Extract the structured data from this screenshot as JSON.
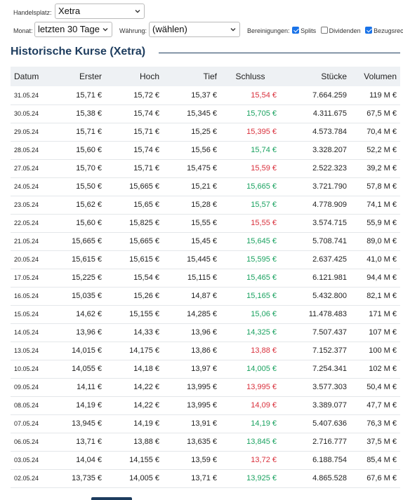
{
  "filters": {
    "exchange_label": "Handelsplatz:",
    "exchange_value": "Xetra",
    "month_label": "Monat:",
    "month_value": "letzten 30 Tage",
    "currency_label": "Währung:",
    "currency_value": "(wählen)",
    "adjust_label": "Bereinigungen:",
    "adjust_options": [
      {
        "label": "Splits",
        "checked": true
      },
      {
        "label": "Dividenden",
        "checked": false
      },
      {
        "label": "Bezugsrec",
        "checked": true
      }
    ]
  },
  "section_title": "Historische Kurse (Xetra)",
  "table": {
    "headers": [
      "Datum",
      "Erster",
      "Hoch",
      "Tief",
      "Schluss",
      "Stücke",
      "Volumen"
    ],
    "rows": [
      [
        "31.05.24",
        "15,71 €",
        "15,72 €",
        "15,37 €",
        "15,54 €",
        "7.664.259",
        "119 M €",
        "down"
      ],
      [
        "30.05.24",
        "15,38 €",
        "15,74 €",
        "15,345 €",
        "15,705 €",
        "4.311.675",
        "67,5 M €",
        "up"
      ],
      [
        "29.05.24",
        "15,71 €",
        "15,71 €",
        "15,25 €",
        "15,395 €",
        "4.573.784",
        "70,4 M €",
        "down"
      ],
      [
        "28.05.24",
        "15,60 €",
        "15,74 €",
        "15,56 €",
        "15,74 €",
        "3.328.207",
        "52,2 M €",
        "up"
      ],
      [
        "27.05.24",
        "15,70 €",
        "15,71 €",
        "15,475 €",
        "15,59 €",
        "2.522.323",
        "39,2 M €",
        "down"
      ],
      [
        "24.05.24",
        "15,50 €",
        "15,665 €",
        "15,21 €",
        "15,665 €",
        "3.721.790",
        "57,8 M €",
        "up"
      ],
      [
        "23.05.24",
        "15,62 €",
        "15,65 €",
        "15,28 €",
        "15,57 €",
        "4.778.909",
        "74,1 M €",
        "up"
      ],
      [
        "22.05.24",
        "15,60 €",
        "15,825 €",
        "15,55 €",
        "15,55 €",
        "3.574.715",
        "55,9 M €",
        "down"
      ],
      [
        "21.05.24",
        "15,665 €",
        "15,665 €",
        "15,45 €",
        "15,645 €",
        "5.708.741",
        "89,0 M €",
        "up"
      ],
      [
        "20.05.24",
        "15,615 €",
        "15,615 €",
        "15,445 €",
        "15,595 €",
        "2.637.425",
        "41,0 M €",
        "up"
      ],
      [
        "17.05.24",
        "15,225 €",
        "15,54 €",
        "15,115 €",
        "15,465 €",
        "6.121.981",
        "94,4 M €",
        "up"
      ],
      [
        "16.05.24",
        "15,035 €",
        "15,26 €",
        "14,87 €",
        "15,165 €",
        "5.432.800",
        "82,1 M €",
        "up"
      ],
      [
        "15.05.24",
        "14,62 €",
        "15,155 €",
        "14,285 €",
        "15,06 €",
        "11.478.483",
        "171 M €",
        "up"
      ],
      [
        "14.05.24",
        "13,96 €",
        "14,33 €",
        "13,96 €",
        "14,325 €",
        "7.507.437",
        "107 M €",
        "up"
      ],
      [
        "13.05.24",
        "14,015 €",
        "14,175 €",
        "13,86 €",
        "13,88 €",
        "7.152.377",
        "100 M €",
        "down"
      ],
      [
        "10.05.24",
        "14,055 €",
        "14,18 €",
        "13,97 €",
        "14,005 €",
        "7.254.341",
        "102 M €",
        "up"
      ],
      [
        "09.05.24",
        "14,11 €",
        "14,22 €",
        "13,995 €",
        "13,995 €",
        "3.577.303",
        "50,4 M €",
        "down"
      ],
      [
        "08.05.24",
        "14,19 €",
        "14,22 €",
        "13,995 €",
        "14,09 €",
        "3.389.077",
        "47,7 M €",
        "down"
      ],
      [
        "07.05.24",
        "13,945 €",
        "14,19 €",
        "13,91 €",
        "14,19 €",
        "5.407.636",
        "76,3 M €",
        "up"
      ],
      [
        "06.05.24",
        "13,71 €",
        "13,88 €",
        "13,635 €",
        "13,845 €",
        "2.716.777",
        "37,5 M €",
        "up"
      ],
      [
        "03.05.24",
        "14,04 €",
        "14,155 €",
        "13,59 €",
        "13,72 €",
        "6.188.754",
        "85,4 M €",
        "down"
      ],
      [
        "02.05.24",
        "13,735 €",
        "14,005 €",
        "13,71 €",
        "13,925 €",
        "4.865.528",
        "67,6 M €",
        "up"
      ]
    ]
  },
  "colors": {
    "up": "#1aa260",
    "down": "#d9303c",
    "title": "#1d3c5e",
    "header_bg": "#eef1f4"
  }
}
